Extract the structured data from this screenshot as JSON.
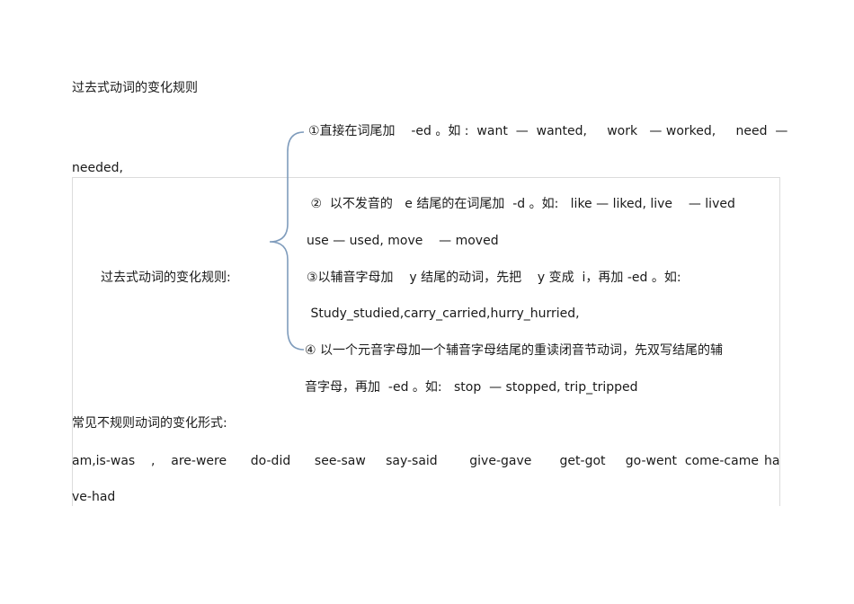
{
  "heading": "过去式动词的变化规则",
  "section_label": "过去式动词的变化规则:",
  "rules": {
    "r1_line1": "①直接在词尾加    -ed 。如 :  want  —  wanted,     work   — worked,     need  —",
    "r1_line2": "needed,",
    "r2_line1": " ②  以不发音的   e 结尾的在词尾加  -d 。如:   like — liked, live    — lived",
    "r2_line2": "use — used, move    — moved",
    "r3_line1": "③以辅音字母加    y 结尾的动词，先把    y 变成  i，再加 -ed 。如:",
    "r3_line2": " Study_studied,carry_carried,hurry_hurried,",
    "r4_line1": "④ 以一个元音字母加一个辅音字母结尾的重读闭音节动词，先双写结尾的辅",
    "r4_line2": "音字母，再加  -ed 。如:   stop  — stopped, trip_tripped"
  },
  "irregular": {
    "label": "常见不规则动词的变化形式:",
    "line1": "am,is-was    ,    are-were      do-did      see-saw     say-said        give-gave       get-got     go-went  come-came",
    "line1_tail": "ha",
    "line2": "ve-had"
  },
  "colors": {
    "brace": "#7f9cbc",
    "text": "#1a1a1a",
    "box_border": "#dcdcdc"
  }
}
